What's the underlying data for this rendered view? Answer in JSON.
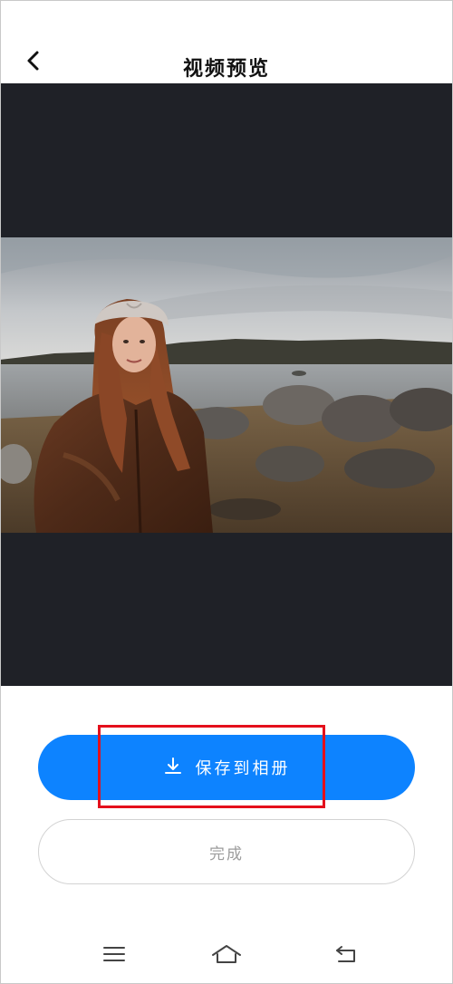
{
  "header": {
    "title": "视频预览",
    "back_icon": "chevron-left-icon"
  },
  "preview": {
    "background_color": "#1f2127",
    "image": "woman-in-headband-by-rocky-shore"
  },
  "actions": {
    "save_label": "保存到相册",
    "save_icon": "download-icon",
    "save_color": "#0d83ff",
    "done_label": "完成"
  },
  "system_nav": {
    "menu_icon": "menu-icon",
    "home_icon": "home-icon",
    "back_icon": "return-icon"
  }
}
